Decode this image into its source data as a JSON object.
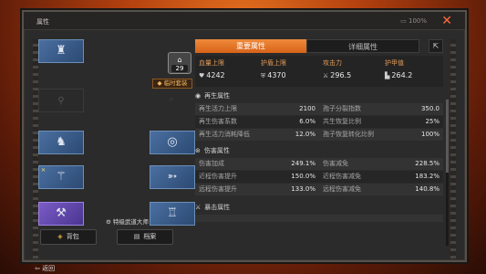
{
  "window": {
    "title": "属性",
    "battery": "100%"
  },
  "equipment": {
    "level": "29",
    "temp_suit": "临时套装",
    "title_badge": "特级武道大师",
    "buttons": {
      "bag": "背包",
      "archive": "档案"
    },
    "back": "返回"
  },
  "tabs": {
    "important": "重要属性",
    "detail": "详细属性"
  },
  "basics": [
    {
      "label": "血量上限",
      "value": "4242",
      "icon": "heart-icon"
    },
    {
      "label": "护盾上限",
      "value": "4370",
      "icon": "shield-icon"
    },
    {
      "label": "攻击力",
      "value": "296.5",
      "icon": "sword-icon"
    },
    {
      "label": "护甲值",
      "value": "264.2",
      "icon": "armor-icon"
    }
  ],
  "sections": {
    "regen": {
      "title": "再生属性",
      "rows": [
        [
          [
            "再生活力上限",
            "2100"
          ],
          [
            "孢子分裂指数",
            "350.0"
          ]
        ],
        [
          [
            "再生伤害系数",
            "6.0%"
          ],
          [
            "共生恢复比例",
            "25%"
          ]
        ],
        [
          [
            "再生活力消耗降低",
            "12.0%"
          ],
          [
            "孢子恢复转化比例",
            "100%"
          ]
        ]
      ]
    },
    "damage": {
      "title": "伤害属性",
      "rows": [
        [
          [
            "伤害加成",
            "249.1%"
          ],
          [
            "伤害减免",
            "228.5%"
          ]
        ],
        [
          [
            "近程伤害提升",
            "150.0%"
          ],
          [
            "近程伤害减免",
            "183.2%"
          ]
        ],
        [
          [
            "远程伤害提升",
            "133.0%"
          ],
          [
            "远程伤害减免",
            "140.8%"
          ]
        ]
      ]
    },
    "crit": {
      "title": "暴击属性"
    }
  }
}
